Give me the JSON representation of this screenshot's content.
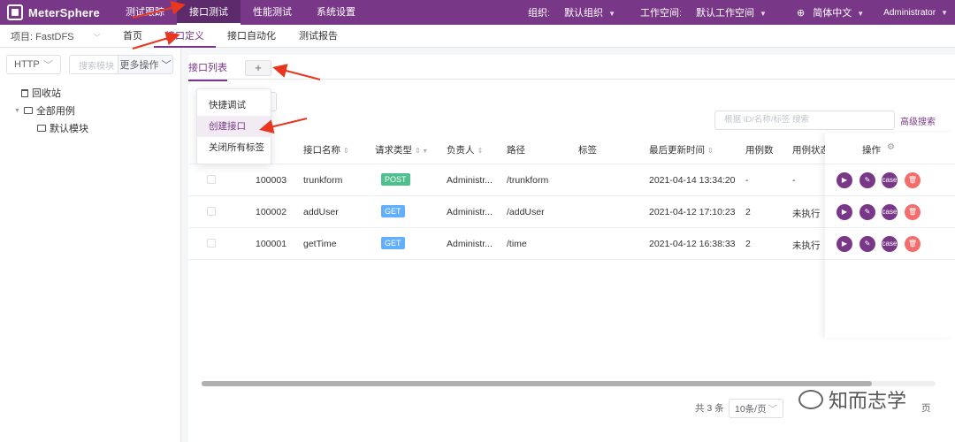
{
  "topnav": {
    "logo_text": "MeterSphere",
    "items": [
      "测试跟踪",
      "接口测试",
      "性能测试",
      "系统设置"
    ],
    "org_label": "组织:",
    "org_value": "默认组织",
    "workspace_label": "工作空间:",
    "workspace_value": "默认工作空间",
    "language": "简体中文",
    "user": "Administrator"
  },
  "subnav": {
    "project": "项目: FastDFS",
    "items": [
      "首页",
      "接口定义",
      "接口自动化",
      "测试报告"
    ]
  },
  "sidebar": {
    "protocol": "HTTP",
    "search_placeholder": "搜索模块",
    "more_ops": "更多操作",
    "tree": {
      "recycle": "回收站",
      "all_cases": "全部用例",
      "default_module": "默认模块"
    }
  },
  "main": {
    "tab_list": "接口列表",
    "tab_add": "+",
    "search_placeholder": "根据 ID/名称/标签 搜索",
    "advanced_search": "高级搜索",
    "columns": [
      "接口名称",
      "请求类型",
      "负责人",
      "路径",
      "标签",
      "最后更新时间",
      "用例数",
      "用例状态",
      "操作"
    ],
    "rows": [
      {
        "id": "100003",
        "name": "trunkform",
        "method": "POST",
        "owner": "Administr...",
        "path": "/trunkform",
        "updated": "2021-04-14 13:34:20",
        "cases": "-",
        "status": "-"
      },
      {
        "id": "100002",
        "name": "addUser",
        "method": "GET",
        "owner": "Administr...",
        "path": "/addUser",
        "updated": "2021-04-12 17:10:23",
        "cases": "2",
        "status": "未执行"
      },
      {
        "id": "100001",
        "name": "getTime",
        "method": "GET",
        "owner": "Administr...",
        "path": "/time",
        "updated": "2021-04-12 16:38:33",
        "cases": "2",
        "status": "未执行"
      }
    ],
    "op_case_label": "case",
    "total": "共 3 条",
    "page_size": "10条/页",
    "goto_suffix": "页"
  },
  "dropdown": {
    "items": [
      "快捷调试",
      "创建接口",
      "关闭所有标签"
    ]
  },
  "watermark": "知而志学",
  "colors": {
    "brand": "#783887",
    "post": "#4fc08d",
    "get": "#61affe",
    "delete": "#f56c6c",
    "annotation": "#e8361f"
  }
}
